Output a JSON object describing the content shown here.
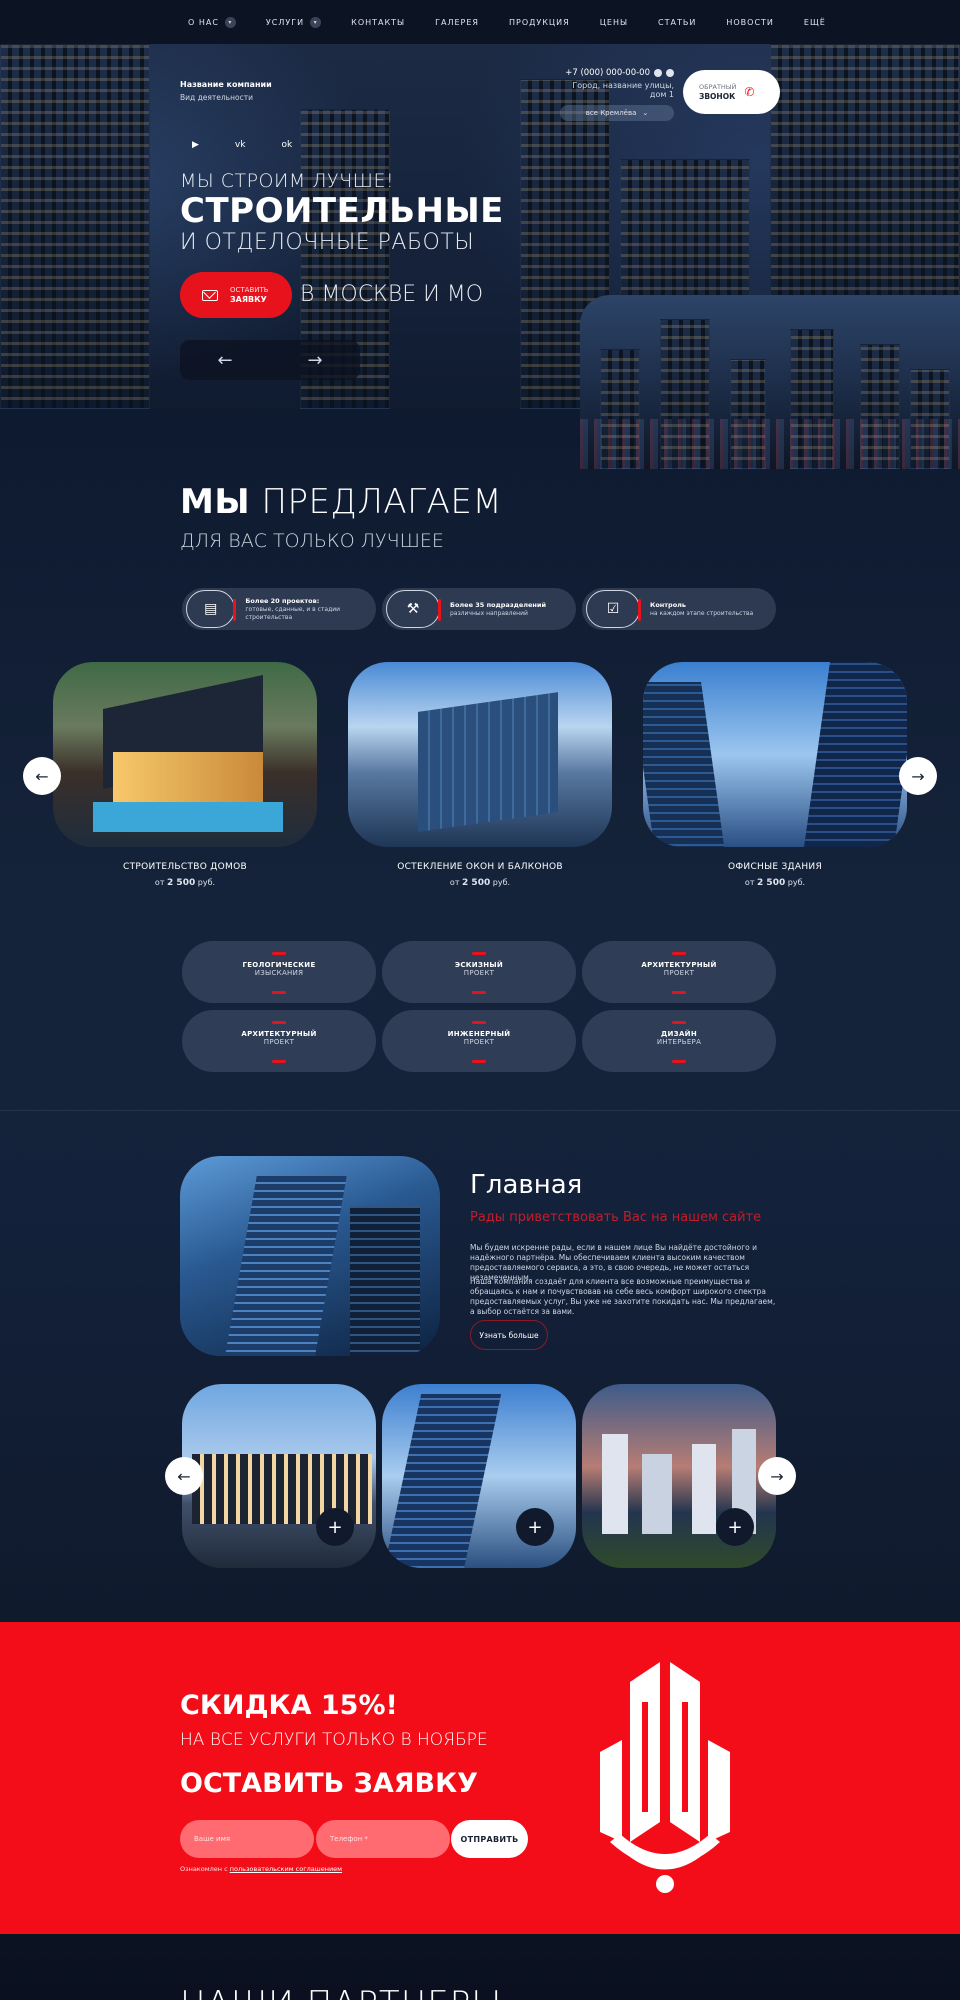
{
  "nav": {
    "items": [
      {
        "label": "О НАС",
        "dropdown": true
      },
      {
        "label": "УСЛУГИ",
        "dropdown": true
      },
      {
        "label": "КОНТАКТЫ",
        "dropdown": false
      },
      {
        "label": "ГАЛЕРЕЯ",
        "dropdown": false
      },
      {
        "label": "ПРОДУКЦИЯ",
        "dropdown": false
      },
      {
        "label": "ЦЕНЫ",
        "dropdown": false
      },
      {
        "label": "СТАТЬИ",
        "dropdown": false
      },
      {
        "label": "НОВОСТИ",
        "dropdown": false
      },
      {
        "label": "ЕЩЁ",
        "dropdown": false
      }
    ]
  },
  "header": {
    "company_name": "Название компании",
    "company_desc": "Вид деятельности",
    "phone": "+7 (000) 000-00-00",
    "address": "Город, название улицы, дом 1",
    "cities": "все Кремлёва",
    "callback_top": "ОБРАТНЫЙ",
    "callback_bottom": "ЗВОНОК",
    "socials": [
      "youtube-icon",
      "vk-icon",
      "ok-icon"
    ]
  },
  "hero": {
    "line1": "МЫ СТРОИМ ЛУЧШЕ!",
    "line2": "СТРОИТЕЛЬНЫЕ",
    "line3": "И ОТДЕЛОЧНЫЕ РАБОТЫ",
    "btn_top": "ОСТАВИТЬ",
    "btn_bottom": "ЗАЯВКУ",
    "city_text": "В МОСКВЕ И МО",
    "prev": "←",
    "next": "→"
  },
  "offer": {
    "title_bold": "МЫ",
    "title_light": "ПРЕДЛАГАЕМ",
    "subtitle": "ДЛЯ ВАС ТОЛЬКО ЛУЧШЕЕ",
    "features": [
      {
        "bold": "Более 20 проектов:",
        "text": "готовые, сданные, и в стадии строительства"
      },
      {
        "bold": "Более 35 подразделений",
        "text": "различных направлений"
      },
      {
        "bold": "Контроль",
        "text": "на каждом этапе строительства"
      }
    ],
    "cards": [
      {
        "title": "СТРОИТЕЛЬСТВО ДОМОВ",
        "price_prefix": "от",
        "price": "2 500",
        "price_suffix": "руб."
      },
      {
        "title": "ОСТЕКЛЕНИЕ ОКОН И БАЛКОНОВ",
        "price_prefix": "от",
        "price": "2 500",
        "price_suffix": "руб."
      },
      {
        "title": "ОФИСНЫЕ ЗДАНИЯ",
        "price_prefix": "от",
        "price": "2 500",
        "price_suffix": "руб."
      }
    ],
    "services": [
      {
        "l1": "ГЕОЛОГИЧЕСКИЕ",
        "l2": "ИЗЫСКАНИЯ"
      },
      {
        "l1": "ЭСКИЗНЫЙ",
        "l2": "ПРОЕКТ"
      },
      {
        "l1": "АРХИТЕКТУРНЫЙ",
        "l2": "ПРОЕКТ"
      },
      {
        "l1": "АРХИТЕКТУРНЫЙ",
        "l2": "ПРОЕКТ"
      },
      {
        "l1": "ИНЖЕНЕРНЫЙ",
        "l2": "ПРОЕКТ"
      },
      {
        "l1": "ДИЗАЙН",
        "l2": "ИНТЕРЬЕРА"
      }
    ]
  },
  "about": {
    "title": "Главная",
    "subtitle": "Рады приветствовать Вас на нашем сайте",
    "p1": "Мы будем искренне рады, если в нашем лице Вы найдёте достойного и надёжного партнёра. Мы обеспечиваем клиента высоким качеством предоставляемого сервиса, а это, в свою очередь, не может остаться незамеченным.",
    "p2": "Наша компания создаёт для клиента все возможные преимущества и обращаясь к нам и почувствовав на себе весь комфорт широкого спектра предоставляемых услуг, Вы уже не захотите покидать нас. Мы предлагаем, а выбор остаётся за вами.",
    "more": "Узнать больше",
    "plus": "+"
  },
  "promo": {
    "line1": "СКИДКА 15%!",
    "line2": "НА ВСЕ УСЛУГИ ТОЛЬКО В НОЯБРЕ",
    "line3": "ОСТАВИТЬ ЗАЯВКУ",
    "name_placeholder": "Ваше имя",
    "phone_placeholder": "Телефон *",
    "send": "ОТПРАВИТЬ",
    "agree_prefix": "Ознакомлен с",
    "agree_link": "пользовательским соглашением"
  },
  "partners": {
    "title": "НАШИ ПАРТНЕРЫ"
  },
  "colors": {
    "accent": "#e8121d",
    "promo": "#f30d18",
    "bg": "#0e1a30"
  }
}
